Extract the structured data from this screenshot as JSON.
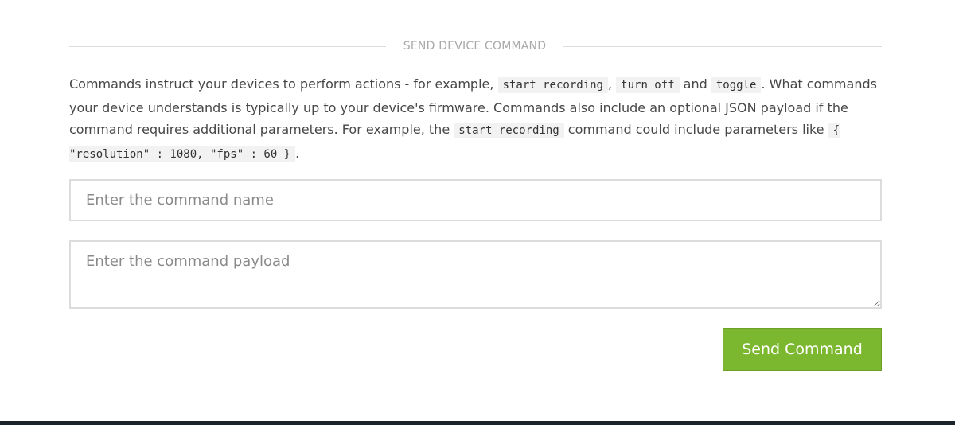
{
  "section": {
    "title": "SEND DEVICE COMMAND"
  },
  "description": {
    "text_1": "Commands instruct your devices to perform actions - for example, ",
    "code_1": "start recording",
    "text_2": ", ",
    "code_2": "turn off",
    "text_3": " and ",
    "code_3": "toggle",
    "text_4": ". What commands your device understands is typically up to your device's firmware. Commands also include an optional JSON payload if the command requires additional parameters. For example, the ",
    "code_4": "start recording",
    "text_5": " command could include parameters like ",
    "code_5": "{ \"resolution\" : 1080, \"fps\" : 60 }",
    "text_6": "."
  },
  "form": {
    "command_name": {
      "value": "",
      "placeholder": "Enter the command name"
    },
    "command_payload": {
      "value": "",
      "placeholder": "Enter the command payload"
    },
    "send_button_label": "Send Command"
  },
  "colors": {
    "accent": "#7cb82f",
    "footer": "#1c2329",
    "rule": "#dcdcdc"
  }
}
